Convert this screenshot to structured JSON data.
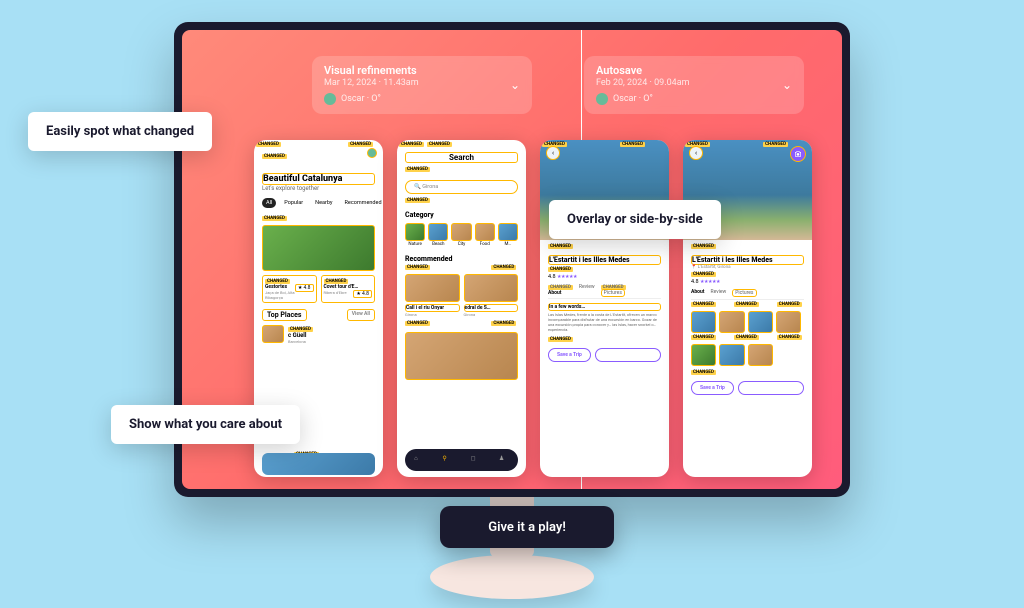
{
  "labels": {
    "spot": "Easily spot what changed",
    "show": "Show what you care about",
    "overlay": "Overlay or side-by-side",
    "cta": "Give it a play!"
  },
  "versions": {
    "left": {
      "title": "Visual refinements",
      "date": "Mar 12, 2024 · 11.43am",
      "user": "Oscar · O°"
    },
    "right": {
      "title": "Autosave",
      "date": "Feb 20, 2024 · 09.04am",
      "user": "Oscar · O°"
    }
  },
  "badge": "CHANGED",
  "phone1": {
    "title": "Beautiful Catalunya",
    "subtitle": "Let's explore together",
    "tabs": [
      "All",
      "Popular",
      "Nearby",
      "Recommended"
    ],
    "cards": [
      {
        "name": "Gestortes",
        "rating": "★ 4.8",
        "loc": "Jaça de Boi, Alta Ribagorça"
      },
      {
        "name": "Covet tour d'E…",
        "rating": "★ 4.8",
        "loc": "Ribera d'Ebre"
      }
    ],
    "topPlaces": "Top Places",
    "viewAll": "View All",
    "item": {
      "name": "c Güell",
      "loc": "Barcelona"
    }
  },
  "phone2": {
    "search": "Search",
    "searchValue": "Girona",
    "category": "Category",
    "cats": [
      "Nature",
      "Beach",
      "City",
      "Food",
      "M…"
    ],
    "recommended": "Recommended",
    "recs": [
      {
        "name": "Call i el riu Onyar",
        "loc": "Girona"
      },
      {
        "name": "edral de S…",
        "loc": "Girona"
      }
    ]
  },
  "detail": {
    "title": "L'Estartit i les Illes Medes",
    "loc": "L'Estartit, Girona",
    "rating": "4.8",
    "stars": "★★★★★",
    "tabs": [
      "About",
      "Review",
      "Pictures"
    ],
    "wordsHeader": "In a few words…",
    "body": "Las Islas Medes, frente a la costa de L'Estartit, ofrecen un marco incomparable para disfrutar de una excursión en barco. Gozar de una excursión propia para conocer y… las islas, hacer snorkel o… experiencia.",
    "save": "Save a Trip"
  }
}
